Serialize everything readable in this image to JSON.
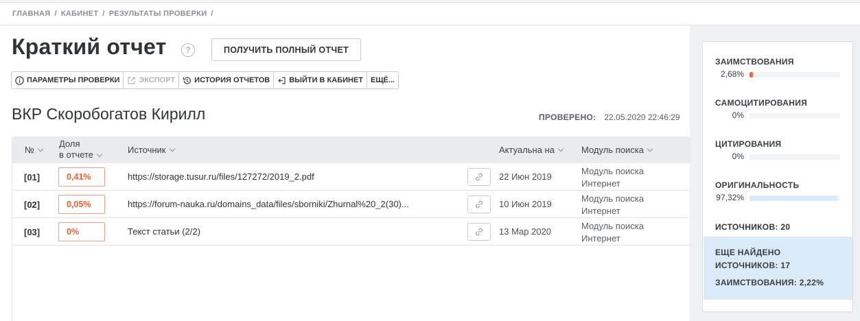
{
  "breadcrumb": [
    "ГЛАВНАЯ",
    "КАБИНЕТ",
    "РЕЗУЛЬТАТЫ ПРОВЕРКИ"
  ],
  "breadcrumb_sep": "/",
  "page": {
    "title": "Краткий отчет",
    "help": "?",
    "full_report_button": "ПОЛУЧИТЬ ПОЛНЫЙ ОТЧЕТ"
  },
  "toolbar": {
    "params": "ПАРАМЕТРЫ ПРОВЕРКИ",
    "export": "ЭКСПОРТ",
    "history": "ИСТОРИЯ ОТЧЕТОВ",
    "exit": "ВЫЙТИ В КАБИНЕТ",
    "more": "ЕЩЁ..."
  },
  "document": {
    "name": "ВКР Скоробогатов Кирилл",
    "checked_label": "ПРОВЕРЕНО:",
    "checked_value": "22.05.2020 22:46:29"
  },
  "table": {
    "headers": {
      "num": "№",
      "share_line1": "Доля",
      "share_line2": "в отчете",
      "source": "Источник",
      "actual": "Актуальна на",
      "module": "Модуль поиска"
    },
    "rows": [
      {
        "num": "[01]",
        "share": "0,41%",
        "source": "https://storage.tusur.ru/files/127272/2019_2.pdf",
        "date": "22 Июн 2019",
        "module1": "Модуль поиска",
        "module2": "Интернет"
      },
      {
        "num": "[02]",
        "share": "0,05%",
        "source": "https://forum-nauka.ru/domains_data/files/sborniki/Zhurnal%20_2(30)...",
        "date": "10 Июн 2019",
        "module1": "Модуль поиска",
        "module2": "Интернет"
      },
      {
        "num": "[03]",
        "share": "0%",
        "source": "Текст статьи (2/2)",
        "date": "13 Мар 2020",
        "module1": "Модуль поиска",
        "module2": "Интернет"
      }
    ]
  },
  "summary": {
    "borrowing": {
      "label": "ЗАИМСТВОВАНИЯ",
      "value": "2,68%",
      "fraction": 0.0268,
      "color": "#ef6a3a"
    },
    "selfcite": {
      "label": "САМОЦИТИРОВАНИЯ",
      "value": "0%",
      "fraction": 0,
      "color": "#f2c84b"
    },
    "cite": {
      "label": "ЦИТИРОВАНИЯ",
      "value": "0%",
      "fraction": 0,
      "color": "#5cb85c"
    },
    "original": {
      "label": "ОРИГИНАЛЬНОСТЬ",
      "value": "97,32%",
      "fraction": 0.9732,
      "color": "#dbeaf7"
    },
    "sources_label": "ИСТОЧНИКОВ:",
    "sources_value": "20",
    "more_found_line1": "ЕЩЕ НАЙДЕНО",
    "more_sources_label": "ИСТОЧНИКОВ:",
    "more_sources_value": "17",
    "more_borrowing_label": "ЗАИМСТВОВАНИЯ:",
    "more_borrowing_value": "2,22%"
  }
}
